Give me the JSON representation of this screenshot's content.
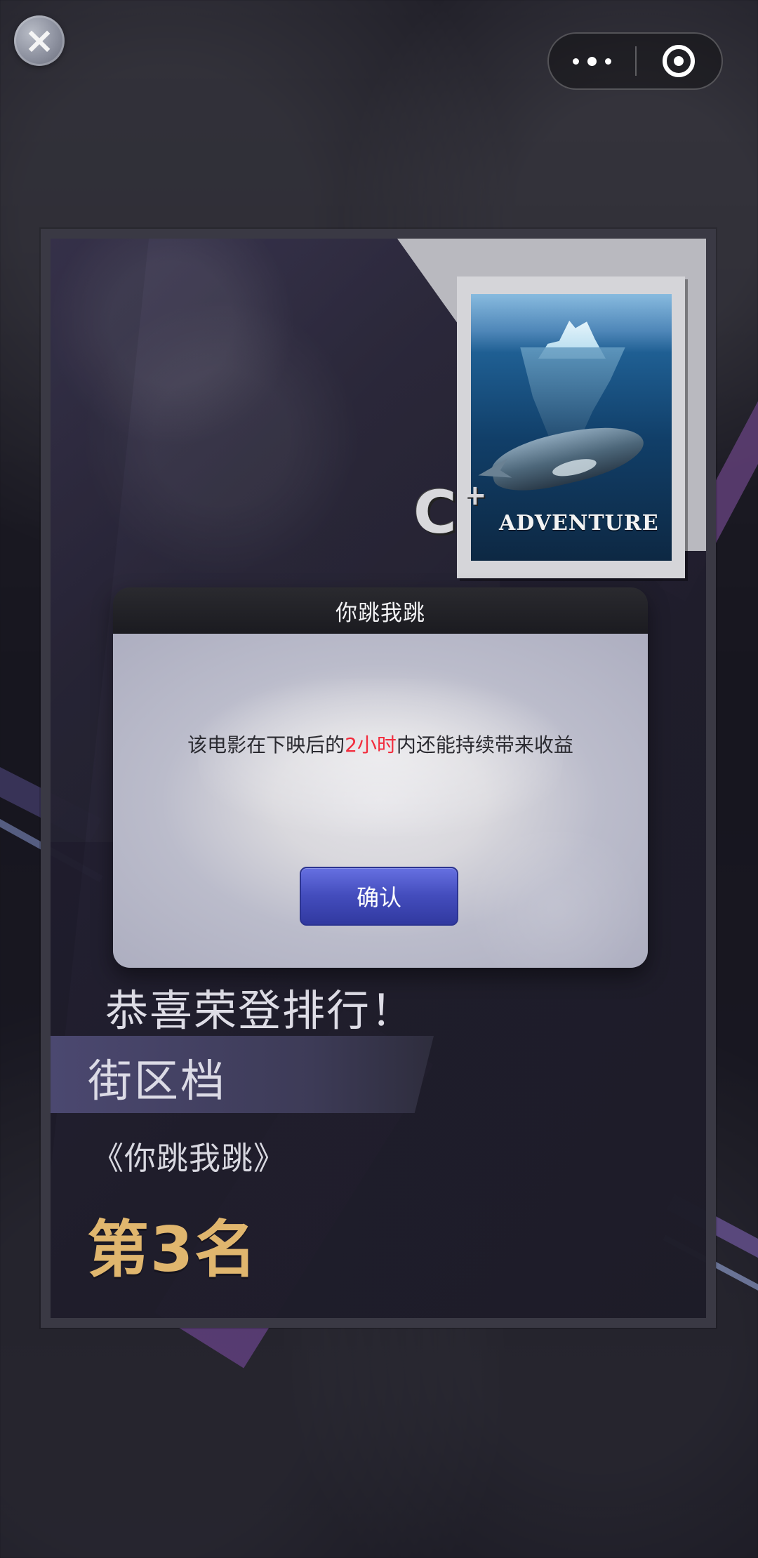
{
  "top_controls": {
    "close_icon": "close-icon",
    "more_icon": "more-icon",
    "record_icon": "record-icon"
  },
  "card": {
    "poster_title": "ADVENTURE",
    "grade_letter": "C",
    "grade_plus": "+",
    "congrats": "恭喜荣登排行！",
    "district": "街区档",
    "movie_name": "《你跳我跳》",
    "rank": "第3名"
  },
  "modal": {
    "title": "你跳我跳",
    "message_prefix": "该电影在下映后的",
    "message_highlight": "2小时",
    "message_suffix": "内还能持续带来收益",
    "confirm_label": "确认"
  },
  "colors": {
    "highlight": "#f22c3d",
    "rank_gold": "#e0b66e",
    "button_blue": "#444dbd"
  }
}
